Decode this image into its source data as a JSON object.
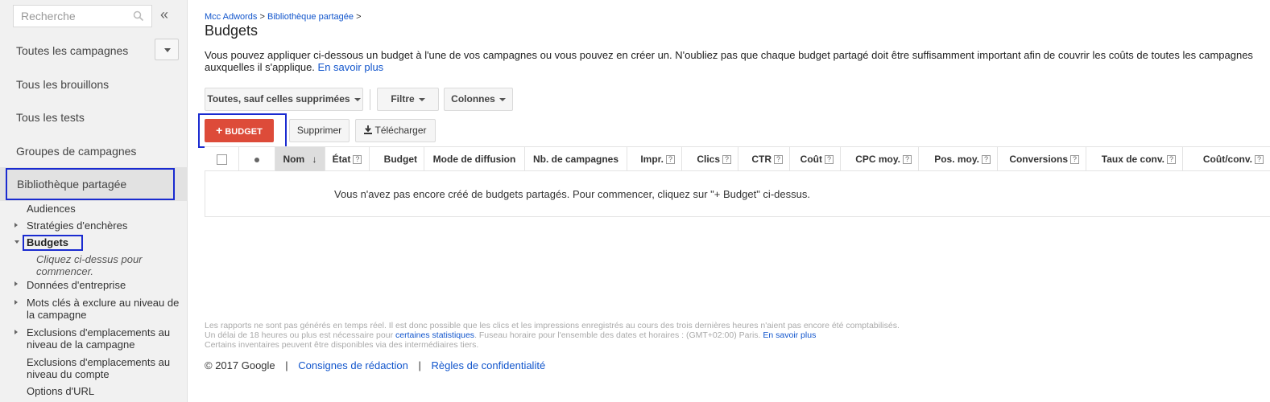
{
  "sidebar": {
    "search_placeholder": "Recherche",
    "collapse_glyph": "«",
    "nav_items": [
      {
        "label": "Toutes les campagnes"
      },
      {
        "label": "Tous les brouillons"
      },
      {
        "label": "Tous les tests"
      },
      {
        "label": "Groupes de campagnes"
      }
    ],
    "shared_library": "Bibliothèque partagée",
    "sub_items": {
      "audiences": "Audiences",
      "bid_strategies": "Stratégies d'enchères",
      "budgets": "Budgets",
      "budgets_hint": "Cliquez ci-dessus pour commencer.",
      "business_data": "Données d'entreprise",
      "negative_keywords": "Mots clés à exclure au niveau de la campagne",
      "placement_exclusions_campaign": "Exclusions d'emplacements au niveau de la campagne",
      "placement_exclusions_account": "Exclusions d'emplacements au niveau du compte",
      "url_options": "Options d'URL"
    }
  },
  "breadcrumb": {
    "root": "Mcc Adwords",
    "separator": ">",
    "current": "Bibliothèque partagée"
  },
  "page_title": "Budgets",
  "intro": {
    "text": "Vous pouvez appliquer ci-dessous un budget à l'une de vos campagnes ou vous pouvez en créer un. N'oubliez pas que chaque budget partagé doit être suffisamment important afin de couvrir les coûts de toutes les campagnes auxquelles il s'applique.",
    "link": "En savoir plus"
  },
  "toolbar": {
    "filter_all": "Toutes, sauf celles supprimées",
    "filter": "Filtre",
    "columns": "Colonnes",
    "add_budget": "BUDGET",
    "add_budget_glyph": "+",
    "delete": "Supprimer",
    "download": "Télécharger"
  },
  "table": {
    "columns": {
      "name": "Nom",
      "status": "État",
      "budget": "Budget",
      "delivery": "Mode de diffusion",
      "campaigns": "Nb. de campagnes",
      "impr": "Impr.",
      "clicks": "Clics",
      "ctr": "CTR",
      "cost": "Coût",
      "avg_cpc": "CPC moy.",
      "avg_pos": "Pos. moy.",
      "conversions": "Conversions",
      "conv_rate": "Taux de conv.",
      "cost_conv": "Coût/conv."
    },
    "help_glyph": "?",
    "sort_glyph": "↓",
    "empty_message": "Vous n'avez pas encore créé de budgets partagés. Pour commencer, cliquez sur \"+ Budget\" ci-dessus."
  },
  "footnote": {
    "line1": "Les rapports ne sont pas générés en temps réel. Il est donc possible que les clics et les impressions enregistrés au cours des trois dernières heures n'aient pas encore été comptabilisés.",
    "line2_a": "Un délai de 18 heures ou plus est nécessaire pour",
    "line2_link": "certaines statistiques",
    "line2_b": ". Fuseau horaire pour l'ensemble des dates et horaires : (GMT+02:00) Paris.",
    "line2_link2": "En savoir plus",
    "line3": "Certains inventaires peuvent être disponibles via des intermédiaires tiers."
  },
  "footer": {
    "copyright": "© 2017 Google",
    "separator": "|",
    "editorial": "Consignes de rédaction",
    "privacy": "Règles de confidentialité"
  },
  "colors": {
    "accent_red": "#dd4b39",
    "link_blue": "#1155cc",
    "highlight_frame": "#1a2bd0"
  }
}
